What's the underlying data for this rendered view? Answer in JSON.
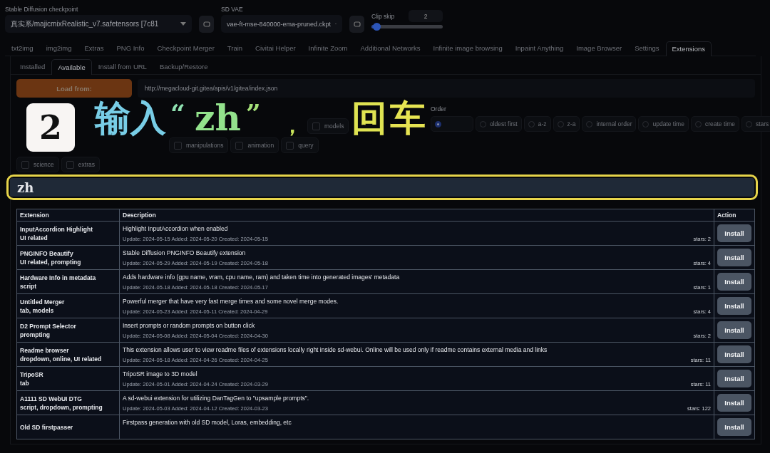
{
  "settings": {
    "checkpoint": {
      "label": "Stable Diffusion checkpoint",
      "value": "真实系/majicmixRealistic_v7.safetensors [7c81"
    },
    "vae": {
      "label": "SD VAE",
      "value": "vae-ft-mse-840000-ema-pruned.ckpt"
    },
    "clip_skip": {
      "label": "Clip skip",
      "value": "2",
      "level": 0.08
    }
  },
  "tabs": [
    {
      "label": "txt2img",
      "selected": false
    },
    {
      "label": "img2img",
      "selected": false
    },
    {
      "label": "Extras",
      "selected": false
    },
    {
      "label": "PNG Info",
      "selected": false
    },
    {
      "label": "Checkpoint Merger",
      "selected": false
    },
    {
      "label": "Train",
      "selected": false
    },
    {
      "label": "Civitai Helper",
      "selected": false
    },
    {
      "label": "Infinite Zoom",
      "selected": false
    },
    {
      "label": "Additional Networks",
      "selected": false
    },
    {
      "label": "Infinite image browsing",
      "selected": false
    },
    {
      "label": "Inpaint Anything",
      "selected": false
    },
    {
      "label": "Image Browser",
      "selected": false
    },
    {
      "label": "Settings",
      "selected": false
    },
    {
      "label": "Extensions",
      "selected": true
    }
  ],
  "subtabs": [
    {
      "label": "Installed",
      "selected": false
    },
    {
      "label": "Available",
      "selected": true
    },
    {
      "label": "Install from URL",
      "selected": false
    },
    {
      "label": "Backup/Restore",
      "selected": false
    }
  ],
  "load_button": "Load from:",
  "url": "http://megacloud-git.gitea/apis/v1/gitea/index.json",
  "tag_rows": [
    [
      {
        "label": "models",
        "checked": false
      }
    ],
    [
      {
        "label": "manipulations",
        "checked": false
      },
      {
        "label": "animation",
        "checked": false
      },
      {
        "label": "query",
        "checked": false
      }
    ],
    [
      {
        "label": "science",
        "checked": false
      },
      {
        "label": "extras",
        "checked": false
      }
    ]
  ],
  "order": {
    "label": "Order",
    "options": [
      {
        "selected": true
      },
      {
        "label": "oldest first",
        "selected": false
      },
      {
        "label": "a-z",
        "selected": false
      },
      {
        "label": "z-a",
        "selected": false
      },
      {
        "label": "internal order",
        "selected": false
      },
      {
        "label": "update time",
        "selected": false
      },
      {
        "label": "create time",
        "selected": false
      },
      {
        "label": "stars",
        "selected": false
      }
    ]
  },
  "overlay": {
    "step": "2",
    "caption_parts": [
      "输入",
      "“",
      "zh",
      "”",
      "，",
      "回",
      "车"
    ]
  },
  "search": {
    "value": "zh"
  },
  "table": {
    "columns": [
      "Extension",
      "Description",
      "Action"
    ],
    "rows": [
      {
        "name": "InputAccordion Highlight",
        "tags": "UI related",
        "description": "Highlight InputAccordion when enabled",
        "dates": "Update: 2024-05-15 Added: 2024-05-20 Created: 2024-05-15",
        "stars": "stars: 2",
        "action": "Install"
      },
      {
        "name": "PNGINFO Beautify",
        "tags": "UI related, prompting",
        "description": "Stable Diffusion PNGINFO Beautify extension",
        "dates": "Update: 2024-05-29 Added: 2024-05-19 Created: 2024-05-18",
        "stars": "stars: 4",
        "action": "Install"
      },
      {
        "name": "Hardware Info in metadata",
        "tags": "script",
        "description": "Adds hardware info (gpu name, vram, cpu name, ram) and taken time into generated images' metadata",
        "dates": "Update: 2024-05-18 Added: 2024-05-18 Created: 2024-05-17",
        "stars": "stars: 1",
        "action": "Install"
      },
      {
        "name": "Untitled Merger",
        "tags": "tab, models",
        "description": "Powerful merger that have very fast merge times and some novel merge modes.",
        "dates": "Update: 2024-05-23 Added: 2024-05-11 Created: 2024-04-29",
        "stars": "stars: 4",
        "action": "Install"
      },
      {
        "name": "D2 Prompt Selector",
        "tags": "prompting",
        "description": "Insert prompts or random prompts on button click",
        "dates": "Update: 2024-05-08 Added: 2024-05-04 Created: 2024-04-30",
        "stars": "stars: 2",
        "action": "Install"
      },
      {
        "name": "Readme browser",
        "tags": "dropdown, online, UI related",
        "description": "This extension allows user to view readme files of extensions locally right inside sd-webui. Online will be used only if readme contains external media and links",
        "dates": "Update: 2024-05-18 Added: 2024-04-26 Created: 2024-04-25",
        "stars": "stars: 11",
        "action": "Install"
      },
      {
        "name": "TripoSR",
        "tags": "tab",
        "description": "TripoSR image to 3D model",
        "dates": "Update: 2024-05-01 Added: 2024-04-24 Created: 2024-03-29",
        "stars": "stars: 11",
        "action": "Install"
      },
      {
        "name": "A1111 SD WebUI DTG",
        "tags": "script, dropdown, prompting",
        "description": "A sd-webui extension for utilizing DanTagGen to \"upsample prompts\".",
        "dates": "Update: 2024-05-03 Added: 2024-04-12 Created: 2024-03-23",
        "stars": "stars: 122",
        "action": "Install"
      },
      {
        "name": "Old SD firstpasser",
        "description": "Firstpass generation with old SD model, Loras, embedding, etc",
        "action": "Install"
      }
    ]
  }
}
